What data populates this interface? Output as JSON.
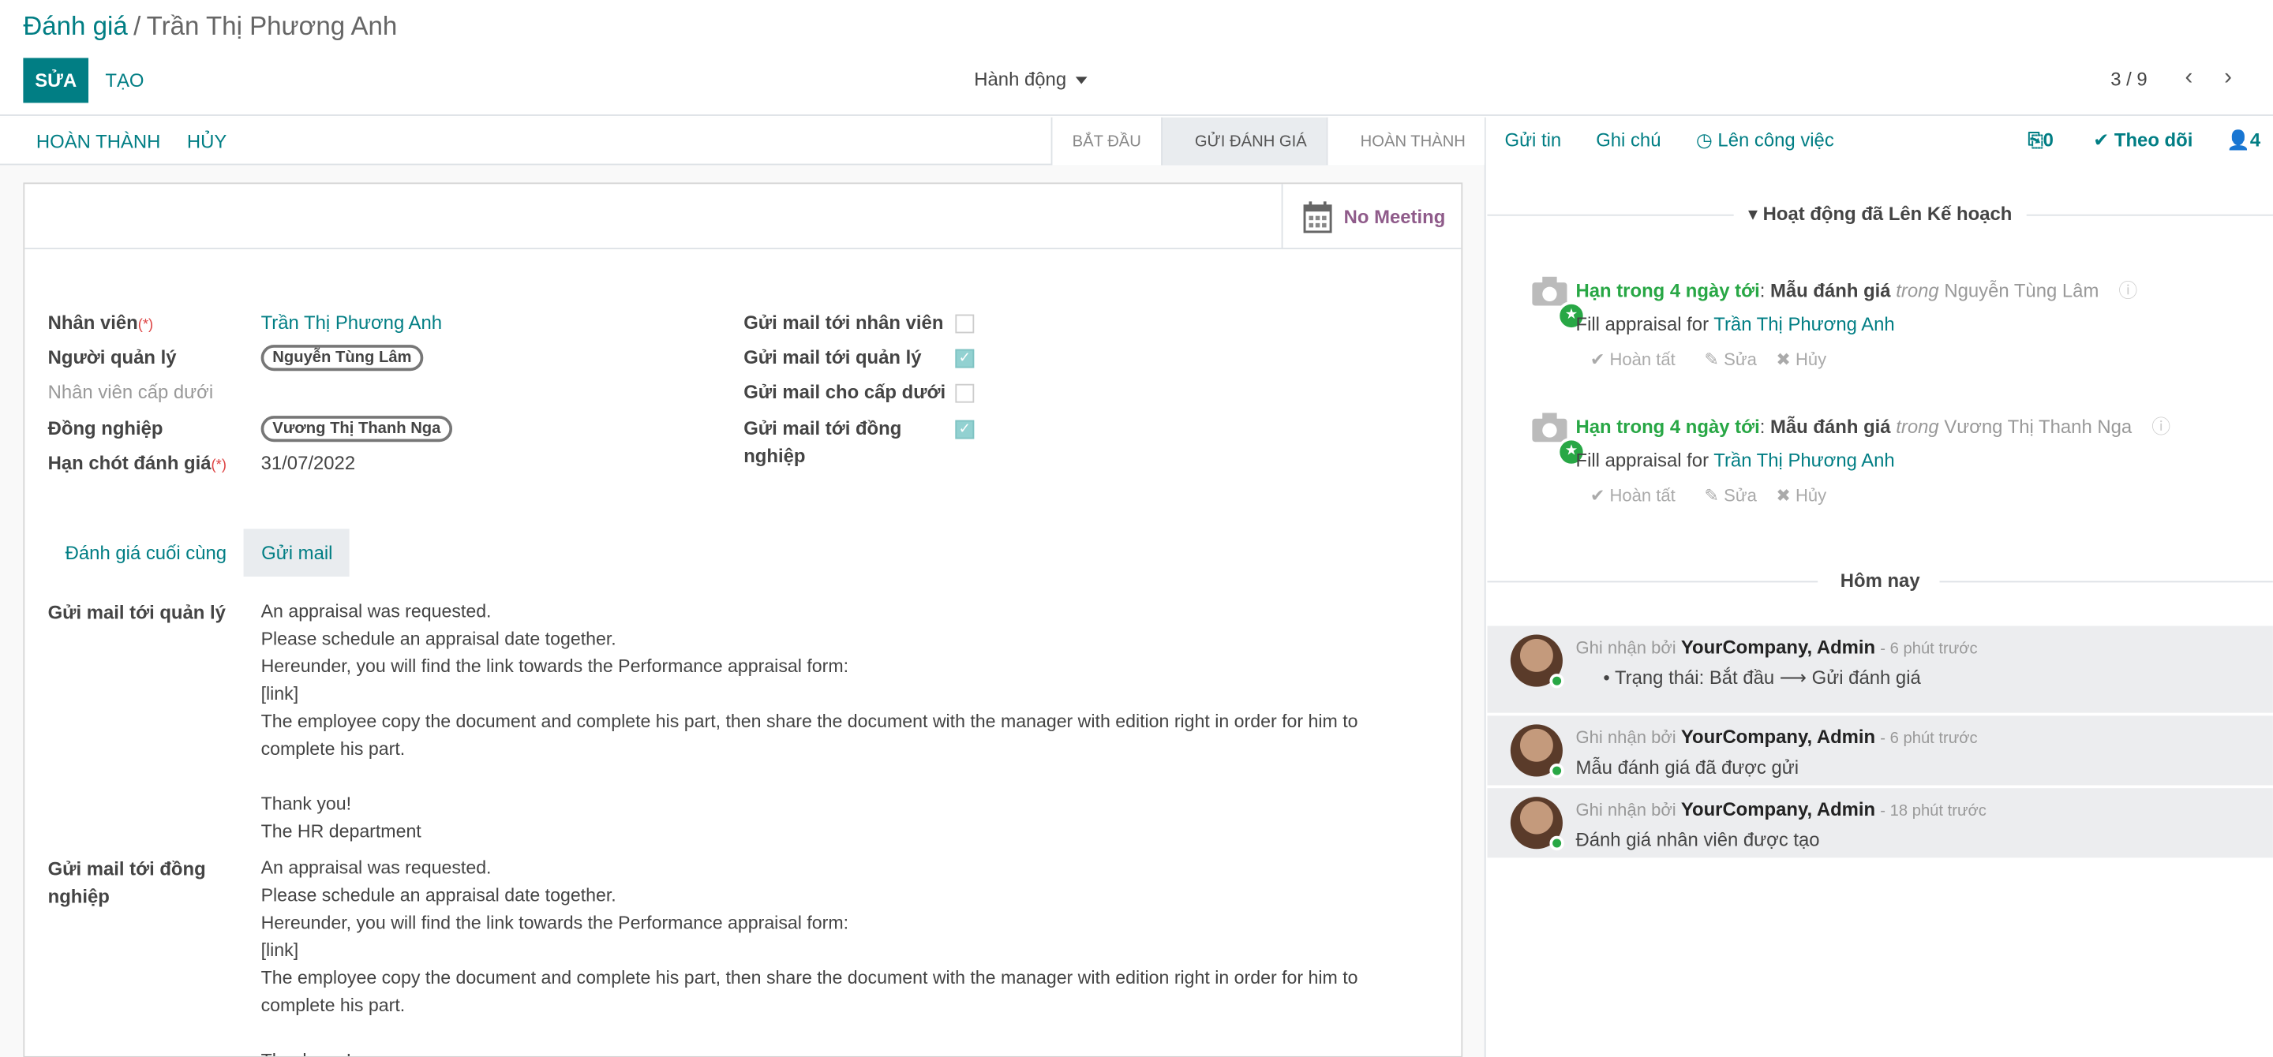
{
  "breadcrumb": {
    "root": "Đánh giá",
    "sep": "/",
    "current": "Trần Thị Phương Anh"
  },
  "toolbar": {
    "edit": "SỬA",
    "create": "TẠO",
    "actions": "Hành động",
    "pager": "3 / 9"
  },
  "header": {
    "buttons": [
      "HOÀN THÀNH",
      "HỦY"
    ],
    "stages": [
      {
        "label": "BẮT ĐẦU"
      },
      {
        "label": "GỬI ĐÁNH GIÁ",
        "active": true
      },
      {
        "label": "HOÀN THÀNH"
      }
    ]
  },
  "meeting": "No Meeting",
  "fields": {
    "employee_label": "Nhân viên",
    "employee": "Trần Thị Phương Anh",
    "manager_label": "Người quản lý",
    "manager": "Nguyễn Tùng Lâm",
    "subordinate_label": "Nhân viên cấp dưới",
    "colleague_label": "Đồng nghiệp",
    "colleague": "Vương Thị Thanh Nga",
    "deadline_label": "Hạn chót đánh giá",
    "deadline": "31/07/2022",
    "required_mark": "(*)",
    "mail_employee_label": "Gửi mail tới nhân viên",
    "mail_employee": false,
    "mail_manager_label": "Gửi mail tới quản lý",
    "mail_manager": true,
    "mail_sub_label": "Gửi mail cho cấp dưới",
    "mail_sub": false,
    "mail_colleague_label": "Gửi mail tới đồng nghiệp",
    "mail_colleague": true
  },
  "tabs": [
    "Đánh giá cuối cùng",
    "Gửi mail"
  ],
  "mail_manager": {
    "label": "Gửi mail tới quản lý",
    "lines": [
      "An appraisal was requested.",
      "Please schedule an appraisal date together.",
      "Hereunder, you will find the link towards the Performance appraisal form:",
      "[link]",
      "The employee copy the document and complete his part, then share the document with the manager with edition right in order for him to complete his part.",
      "",
      "Thank you!",
      "The HR department"
    ]
  },
  "mail_colleague": {
    "label": "Gửi mail tới đồng nghiệp",
    "lines": [
      "An appraisal was requested.",
      "Please schedule an appraisal date together.",
      "Hereunder, you will find the link towards the Performance appraisal form:",
      "[link]",
      "The employee copy the document and complete his part, then share the document with the manager with edition right in order for him to complete his part.",
      "",
      "Thank you!"
    ]
  },
  "chatter": {
    "send": "Gửi tin",
    "note": "Ghi chú",
    "schedule": "Lên công việc",
    "attachments": "0",
    "follow": "Theo dõi",
    "followers": "4",
    "planned_title": "Hoạt động đã Lên Kế hoạch",
    "activities": [
      {
        "due": "Hạn trong 4 ngày tới",
        "summary": "Mẫu đánh giá",
        "in": "trong",
        "user": "Nguyễn Tùng Lâm",
        "text": "Fill appraisal for",
        "link": "Trần Thị Phương Anh",
        "done": "Hoàn tất",
        "edit": "Sửa",
        "cancel": "Hủy"
      },
      {
        "due": "Hạn trong 4 ngày tới",
        "summary": "Mẫu đánh giá",
        "in": "trong",
        "user": "Vương Thị Thanh Nga",
        "text": "Fill appraisal for",
        "link": "Trần Thị Phương Anh",
        "done": "Hoàn tất",
        "edit": "Sửa",
        "cancel": "Hủy"
      }
    ],
    "today": "Hôm nay",
    "messages": [
      {
        "by": "Ghi nhận bởi",
        "author": "YourCompany, Admin",
        "time": "- 6 phút trước",
        "body": "Trạng thái: Bắt đầu ⟶ Gửi đánh giá"
      },
      {
        "by": "Ghi nhận bởi",
        "author": "YourCompany, Admin",
        "time": "- 6 phút trước",
        "body": "Mẫu đánh giá đã được gửi"
      },
      {
        "by": "Ghi nhận bởi",
        "author": "YourCompany, Admin",
        "time": "- 18 phút trước",
        "body": "Đánh giá nhân viên được tạo"
      }
    ]
  }
}
